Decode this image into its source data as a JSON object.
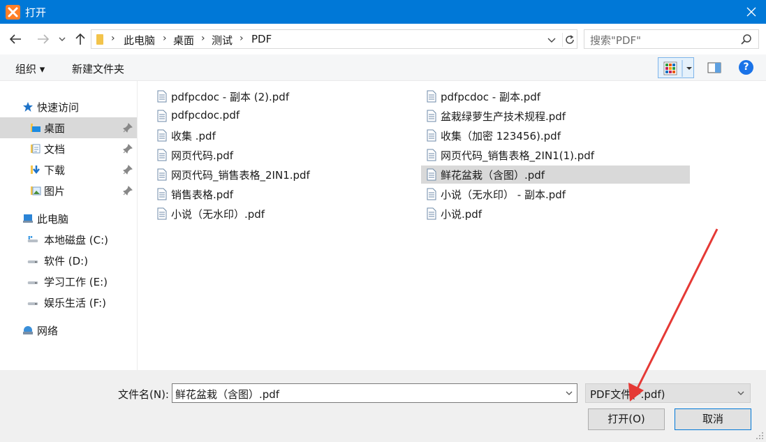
{
  "window": {
    "title": "打开"
  },
  "address": {
    "crumbs": [
      "此电脑",
      "桌面",
      "测试",
      "PDF"
    ],
    "search_placeholder": "搜索\"PDF\""
  },
  "toolbar": {
    "organize": "组织 ▾",
    "new_folder": "新建文件夹",
    "help": "?"
  },
  "sidebar": {
    "items": [
      {
        "label": "快速访问",
        "icon": "star-icon"
      },
      {
        "label": "桌面",
        "icon": "desktop-folder-icon",
        "pinned": true,
        "selected": true
      },
      {
        "label": "文档",
        "icon": "documents-folder-icon",
        "pinned": true
      },
      {
        "label": "下载",
        "icon": "downloads-folder-icon",
        "pinned": true
      },
      {
        "label": "图片",
        "icon": "pictures-folder-icon",
        "pinned": true
      },
      {
        "label": "此电脑",
        "icon": "computer-icon"
      },
      {
        "label": "本地磁盘 (C:)",
        "icon": "system-drive-icon"
      },
      {
        "label": "软件 (D:)",
        "icon": "drive-icon"
      },
      {
        "label": "学习工作 (E:)",
        "icon": "drive-icon"
      },
      {
        "label": "娱乐生活 (F:)",
        "icon": "drive-icon"
      },
      {
        "label": "网络",
        "icon": "network-icon"
      }
    ]
  },
  "files": {
    "column1": [
      "pdfpcdoc - 副本 (2).pdf",
      "pdfpcdoc.pdf",
      "收集 .pdf",
      "网页代码.pdf",
      "网页代码_销售表格_2IN1.pdf",
      "销售表格.pdf",
      "小说（无水印）.pdf"
    ],
    "column2": [
      "pdfpcdoc - 副本.pdf",
      "盆栽绿萝生产技术规程.pdf",
      "收集（加密 123456).pdf",
      "网页代码_销售表格_2IN1(1).pdf",
      "鲜花盆栽（含图）.pdf",
      "小说（无水印） - 副本.pdf",
      "小说.pdf"
    ],
    "selected": "鲜花盆栽（含图）.pdf"
  },
  "bottom": {
    "filename_label": "文件名(N):",
    "filename_value": "鲜花盆栽（含图）.pdf",
    "filetype_value": "PDF文件(*.pdf)",
    "open_label": "打开(O)",
    "cancel_label": "取消"
  },
  "colors": {
    "titlebar": "#0078d7",
    "selection": "#d9d9d9",
    "annotation_arrow": "#e53935"
  }
}
